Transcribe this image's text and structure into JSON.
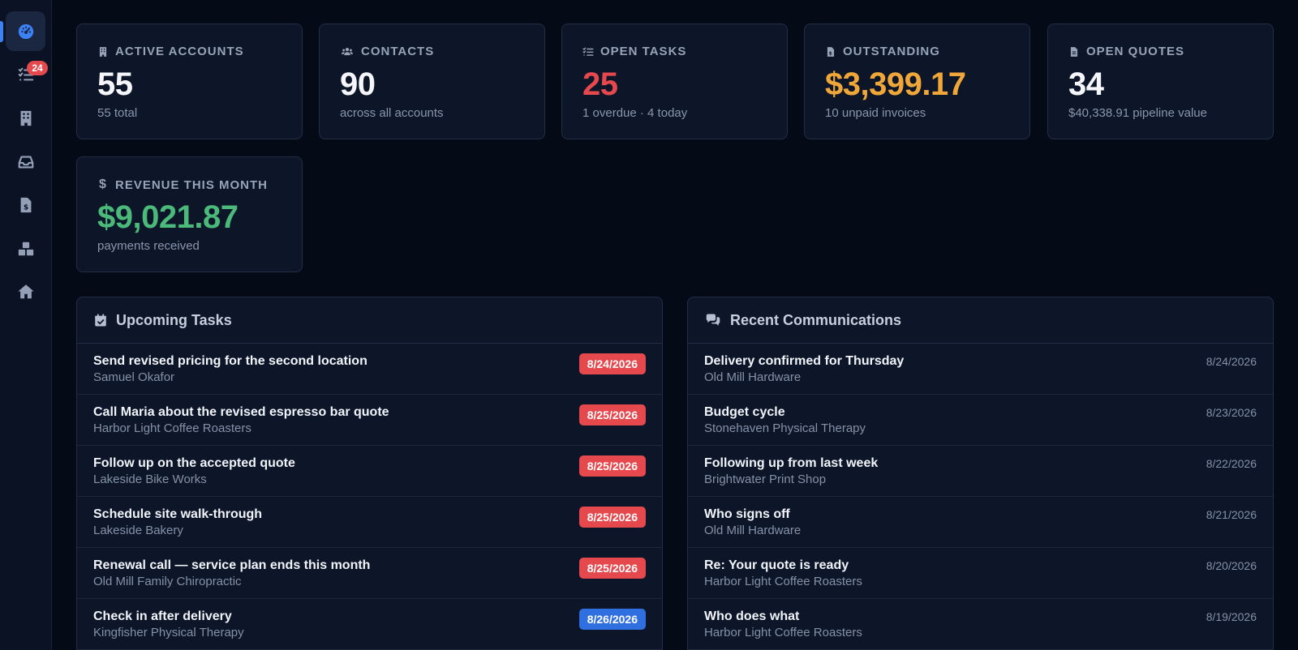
{
  "colors": {
    "accent": "#3b82f6",
    "danger": "#e5484d",
    "warning": "#f0a73a",
    "success": "#4ab97a",
    "overdue_pill": "#e5484d",
    "upcoming_pill": "#2f6fe0"
  },
  "sidebar": {
    "items": [
      {
        "name": "dashboard",
        "icon": "gauge-icon",
        "active": true
      },
      {
        "name": "tasks",
        "icon": "task-list-icon",
        "badge": "24"
      },
      {
        "name": "accounts",
        "icon": "building-icon"
      },
      {
        "name": "inbox",
        "icon": "inbox-icon"
      },
      {
        "name": "invoices",
        "icon": "invoice-icon"
      },
      {
        "name": "inventory",
        "icon": "boxes-icon"
      },
      {
        "name": "home",
        "icon": "home-icon"
      }
    ]
  },
  "stats": {
    "active_accounts": {
      "label": "ACTIVE ACCOUNTS",
      "value": "55",
      "sub": "55 total",
      "icon": "building-icon"
    },
    "contacts": {
      "label": "CONTACTS",
      "value": "90",
      "sub": "across all accounts",
      "icon": "users-icon"
    },
    "open_tasks": {
      "label": "OPEN TASKS",
      "value": "25",
      "sub": "1 overdue · 4 today",
      "icon": "task-list-icon"
    },
    "outstanding": {
      "label": "OUTSTANDING",
      "value": "$3,399.17",
      "sub": "10 unpaid invoices",
      "icon": "invoice-icon"
    },
    "open_quotes": {
      "label": "OPEN QUOTES",
      "value": "34",
      "sub": "$40,338.91 pipeline value",
      "icon": "document-icon"
    },
    "revenue": {
      "label": "REVENUE THIS MONTH",
      "value": "$9,021.87",
      "sub": "payments received",
      "icon": "dollar-icon"
    }
  },
  "tasks_panel": {
    "title": "Upcoming Tasks",
    "icon": "calendar-check-icon",
    "rows": [
      {
        "title": "Send revised pricing for the second location",
        "sub": "Samuel Okafor",
        "date": "8/24/2026",
        "status": "overdue"
      },
      {
        "title": "Call Maria about the revised espresso bar quote",
        "sub": "Harbor Light Coffee Roasters",
        "date": "8/25/2026",
        "status": "overdue"
      },
      {
        "title": "Follow up on the accepted quote",
        "sub": "Lakeside Bike Works",
        "date": "8/25/2026",
        "status": "overdue"
      },
      {
        "title": "Schedule site walk-through",
        "sub": "Lakeside Bakery",
        "date": "8/25/2026",
        "status": "overdue"
      },
      {
        "title": "Renewal call — service plan ends this month",
        "sub": "Old Mill Family Chiropractic",
        "date": "8/25/2026",
        "status": "overdue"
      },
      {
        "title": "Check in after delivery",
        "sub": "Kingfisher Physical Therapy",
        "date": "8/26/2026",
        "status": "upcoming"
      }
    ]
  },
  "comms_panel": {
    "title": "Recent Communications",
    "icon": "chat-bubbles-icon",
    "rows": [
      {
        "title": "Delivery confirmed for Thursday",
        "sub": "Old Mill Hardware",
        "date": "8/24/2026"
      },
      {
        "title": "Budget cycle",
        "sub": "Stonehaven Physical Therapy",
        "date": "8/23/2026"
      },
      {
        "title": "Following up from last week",
        "sub": "Brightwater Print Shop",
        "date": "8/22/2026"
      },
      {
        "title": "Who signs off",
        "sub": "Old Mill Hardware",
        "date": "8/21/2026"
      },
      {
        "title": "Re: Your quote is ready",
        "sub": "Harbor Light Coffee Roasters",
        "date": "8/20/2026"
      },
      {
        "title": "Who does what",
        "sub": "Harbor Light Coffee Roasters",
        "date": "8/19/2026"
      }
    ]
  }
}
